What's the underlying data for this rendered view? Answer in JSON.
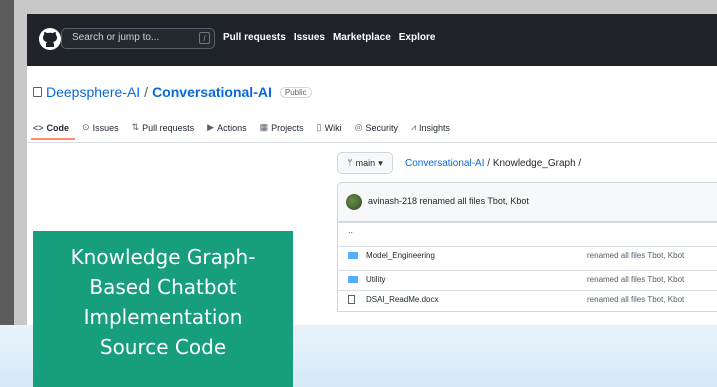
{
  "topbar": {
    "search_placeholder": "Search or jump to...",
    "search_key": "/",
    "nav": [
      "Pull requests",
      "Issues",
      "Marketplace",
      "Explore"
    ]
  },
  "repo": {
    "owner": "Deepsphere-AI",
    "separator": "/",
    "name": "Conversational-AI",
    "visibility": "Public"
  },
  "tabs": [
    {
      "icon": "code-icon",
      "glyph": "<>",
      "label": "Code"
    },
    {
      "icon": "issues-icon",
      "glyph": "⊙",
      "label": "Issues"
    },
    {
      "icon": "pull-request-icon",
      "glyph": "⇅",
      "label": "Pull requests"
    },
    {
      "icon": "actions-icon",
      "glyph": "▶",
      "label": "Actions"
    },
    {
      "icon": "projects-icon",
      "glyph": "▦",
      "label": "Projects"
    },
    {
      "icon": "wiki-icon",
      "glyph": "▯",
      "label": "Wiki"
    },
    {
      "icon": "security-icon",
      "glyph": "◎",
      "label": "Security"
    },
    {
      "icon": "insights-icon",
      "glyph": "⩘",
      "label": "Insights"
    }
  ],
  "branch": {
    "label": "main"
  },
  "breadcrumb": {
    "repo": "Conversational-AI",
    "path": " / Knowledge_Graph /"
  },
  "commit": {
    "text": "avinash-218 renamed all files Tbot, Kbot"
  },
  "files": [
    {
      "type": "parent",
      "name": ".."
    },
    {
      "type": "folder",
      "name": "Model_Engineering",
      "message": "renamed all files Tbot, Kbot"
    },
    {
      "type": "folder",
      "name": "Utility",
      "message": "renamed all files Tbot, Kbot"
    },
    {
      "type": "file",
      "name": "DSAI_ReadMe.docx",
      "message": "renamed all files Tbot, Kbot"
    }
  ],
  "caption": {
    "lines": [
      "Knowledge Graph-",
      "Based Chatbot",
      "Implementation",
      "Source Code"
    ]
  },
  "colors": {
    "topbar": "#1f2328",
    "link": "#0969da",
    "caption_bg": "#179e7d",
    "folder": "#54aeff"
  }
}
